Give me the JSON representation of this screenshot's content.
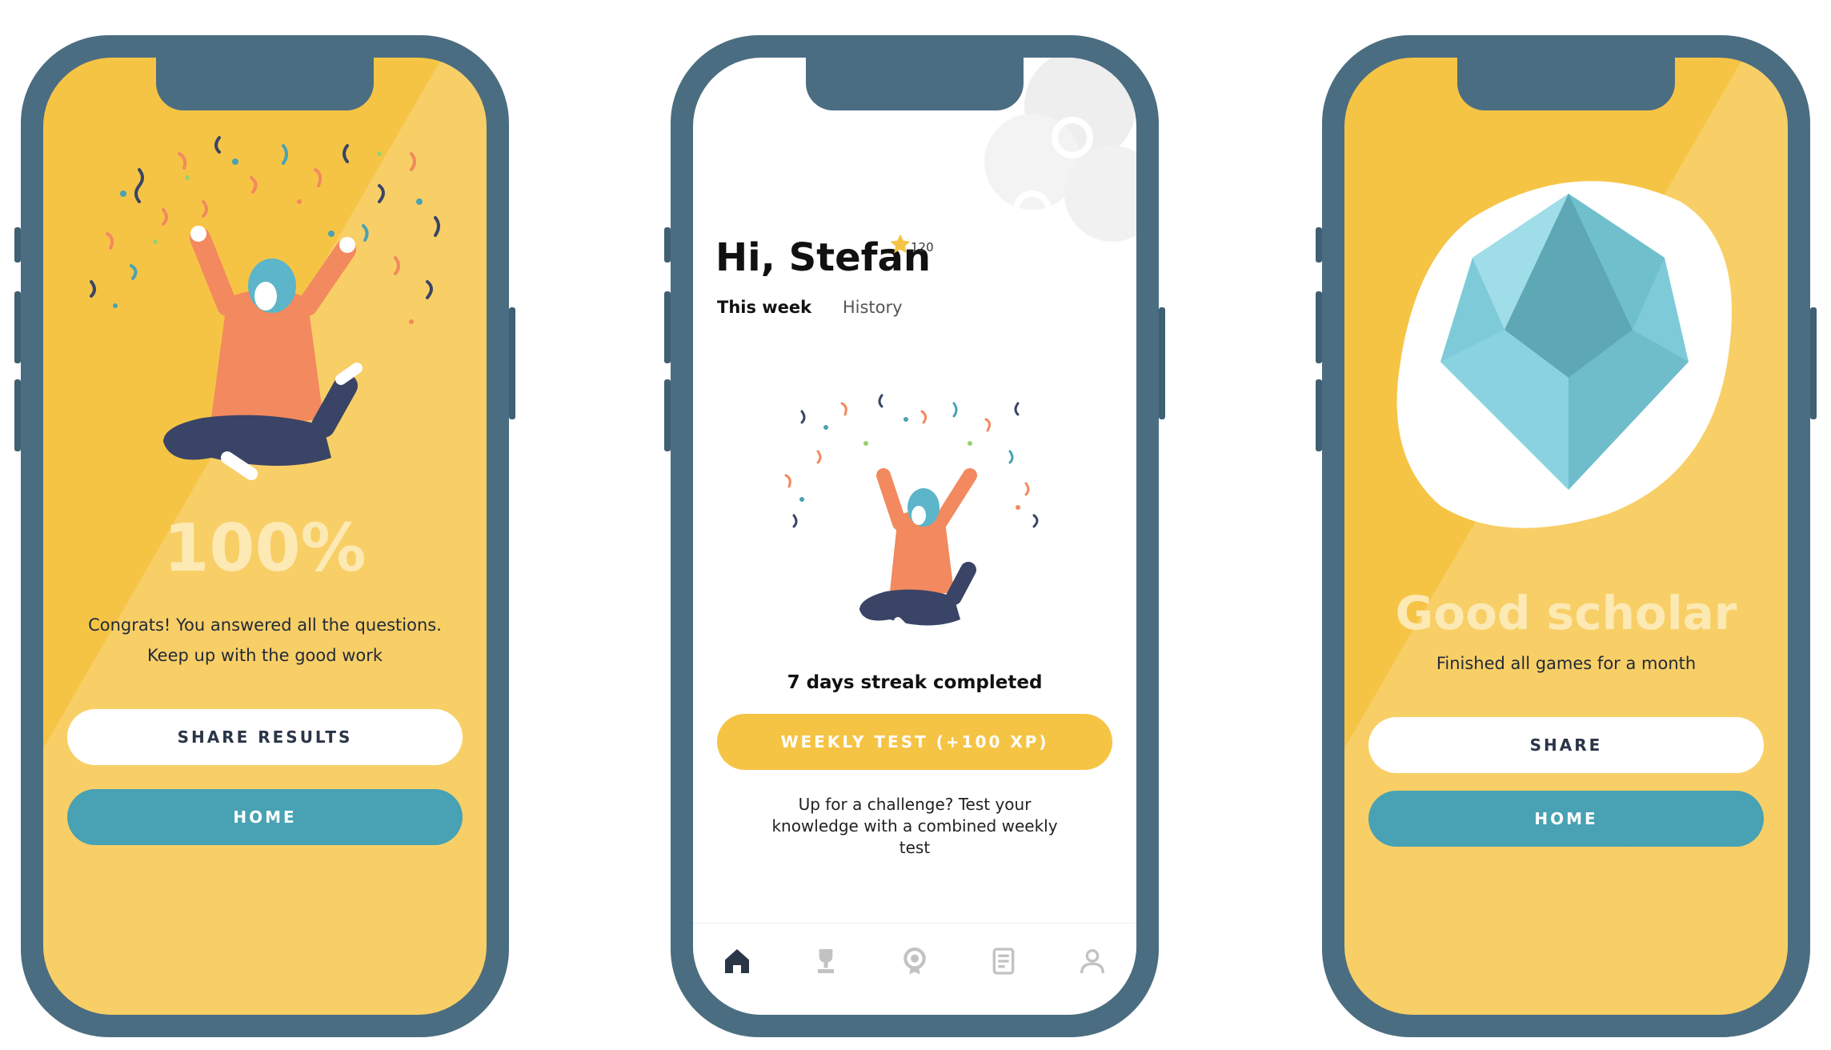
{
  "phone1": {
    "percent": "100%",
    "message_line1": "Congrats! You answered all the questions.",
    "message_line2": "Keep up with the good work",
    "share_label": "SHARE RESULTS",
    "home_label": "HOME"
  },
  "phone2": {
    "greeting": "Hi, Stefan",
    "xp_points": "120",
    "tabs": [
      {
        "label": "This week",
        "active": true
      },
      {
        "label": "History",
        "active": false
      }
    ],
    "streak_text": "7 days streak completed",
    "weekly_test_label": "WEEKLY TEST (+100 XP)",
    "challenge_text": "Up for a challenge? Test your knowledge with a combined weekly test",
    "nav_items": [
      "home-icon",
      "trophy-icon",
      "badge-icon",
      "document-icon",
      "profile-icon"
    ]
  },
  "phone3": {
    "title": "Good scholar",
    "subtitle": "Finished all games for a month",
    "share_label": "SHARE",
    "home_label": "HOME"
  },
  "colors": {
    "frame": "#4b6d81",
    "yellow": "#f6c445",
    "teal": "#48a2b3",
    "orange": "#f3895f",
    "navy": "#3a4466",
    "gem": "#7ecad8"
  }
}
